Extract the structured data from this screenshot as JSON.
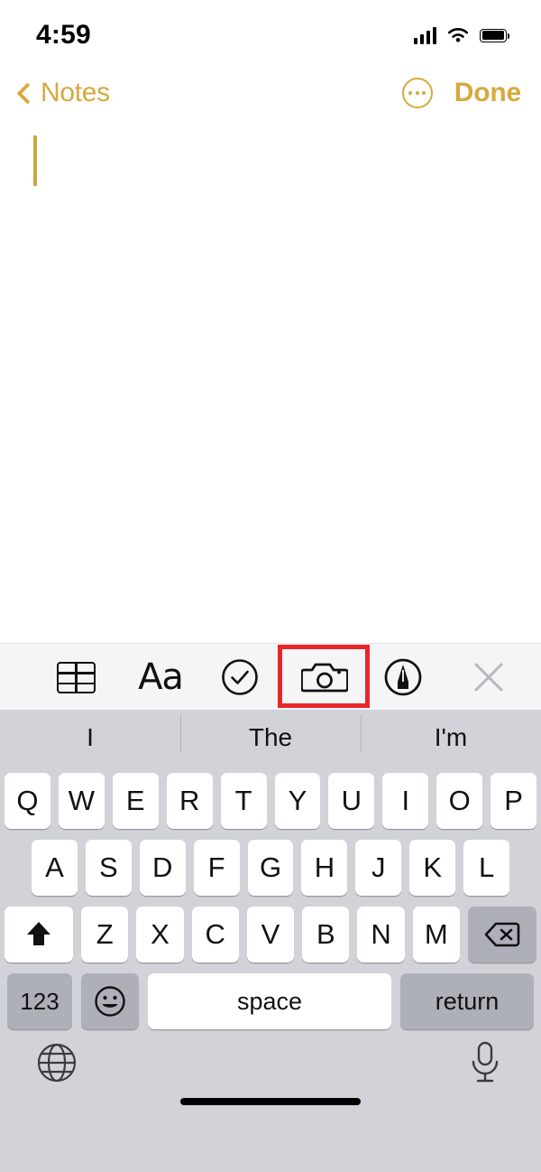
{
  "status_bar": {
    "time": "4:59",
    "cellular_icon": "signal-bars-icon",
    "wifi_icon": "wifi-icon",
    "battery_icon": "battery-full-icon"
  },
  "nav_bar": {
    "back_label": "Notes",
    "back_chevron_icon": "chevron-left-icon",
    "more_icon": "more-options-icon",
    "done_label": "Done",
    "accent_color": "#d6a93c"
  },
  "note": {
    "body_text": "",
    "caret_color": "#c9a93f"
  },
  "format_toolbar": {
    "background": "#f5f5f7",
    "items": [
      {
        "name": "table-icon",
        "label": ""
      },
      {
        "name": "text-format-icon",
        "label": "Aa"
      },
      {
        "name": "checklist-icon",
        "label": ""
      },
      {
        "name": "camera-icon",
        "label": ""
      },
      {
        "name": "markup-pen-icon",
        "label": ""
      },
      {
        "name": "close-icon",
        "label": ""
      }
    ],
    "highlight": {
      "target": "camera-icon",
      "color": "#e8262a"
    }
  },
  "keyboard": {
    "background": "#d1d3d9",
    "predictions": [
      "I",
      "The",
      "I'm"
    ],
    "row1": [
      "Q",
      "W",
      "E",
      "R",
      "T",
      "Y",
      "U",
      "I",
      "O",
      "P"
    ],
    "row2": [
      "A",
      "S",
      "D",
      "F",
      "G",
      "H",
      "J",
      "K",
      "L"
    ],
    "row3": [
      "Z",
      "X",
      "C",
      "V",
      "B",
      "N",
      "M"
    ],
    "shift_icon": "shift-icon",
    "delete_icon": "delete-backspace-icon",
    "numbers_label": "123",
    "emoji_icon": "emoji-smiley-icon",
    "space_label": "space",
    "return_label": "return",
    "globe_icon": "globe-icon",
    "mic_icon": "microphone-icon"
  }
}
